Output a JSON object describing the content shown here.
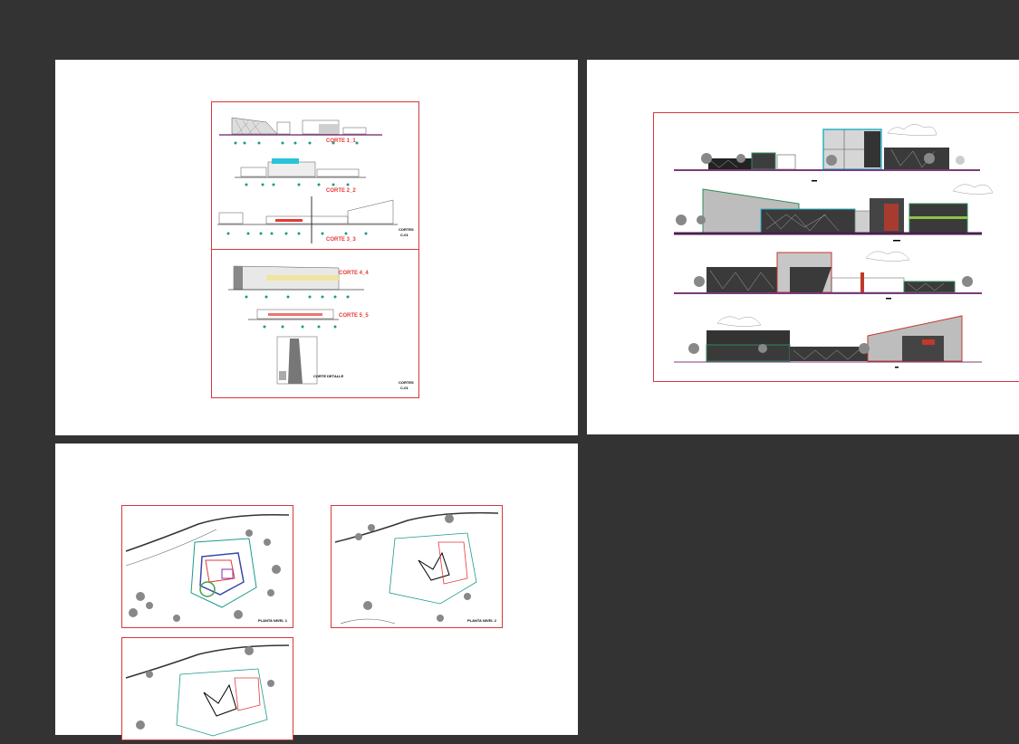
{
  "viewer": {
    "background": "#333333",
    "sheet_color": "#ffffff",
    "frame_color": "#d9363b"
  },
  "sheets": [
    {
      "name": "sections-sheet",
      "sections": [
        "CORTE 1_1",
        "CORTE 2_2",
        "CORTE 3_3",
        "CORTE 4_4",
        "CORTE 5_5"
      ],
      "detail_label": "CORTE DETALLE",
      "stamp": [
        "CORTES",
        "C-01"
      ]
    },
    {
      "name": "elevations-sheet",
      "elevations": [
        "elevation-1",
        "elevation-2",
        "elevation-3",
        "elevation-4"
      ]
    },
    {
      "name": "plans-sheet",
      "plans": [
        {
          "stamp": "PLANTA NIVEL 1"
        },
        {
          "stamp": "PLANTA NIVEL 2"
        },
        {
          "stamp": ""
        }
      ]
    }
  ]
}
